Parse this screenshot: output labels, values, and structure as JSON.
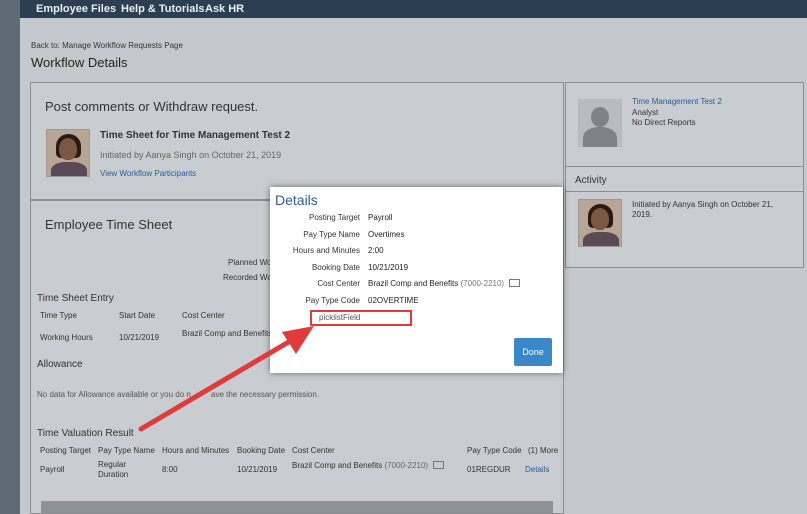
{
  "nav": {
    "items": [
      "Employee Files",
      "Help & Tutorials",
      "Ask HR"
    ]
  },
  "breadcrumb": "Back to: Manage Workflow Requests Page",
  "page_title": "Workflow Details",
  "comments_panel": {
    "title": "Post comments or Withdraw request.",
    "request_title": "Time Sheet for Time Management Test 2",
    "initiated": "Initiated by Aanya Singh on October 21, 2019",
    "participants_link": "View Workflow Participants"
  },
  "profile": {
    "name": "Time Management Test 2",
    "role": "Analyst",
    "reports": "No Direct Reports"
  },
  "activity": {
    "title": "Activity",
    "entry": [
      "Initiated by Aanya Singh on October 21,",
      "2019."
    ]
  },
  "timesheet": {
    "title": "Employee Time Sheet",
    "planned_label": "Planned Wo",
    "recorded_label": "Recorded Wo",
    "entry_title": "Time Sheet Entry",
    "entry_headers": [
      "Time Type",
      "Start Date",
      "Cost Center"
    ],
    "entry_row": [
      "Working Hours",
      "10/21/2019",
      "Brazil Comp and Benefits"
    ],
    "allowance_title": "Allowance",
    "allowance_text": "No data for Allowance available or you do n",
    "allowance_text_tail": "ave the necessary permission.",
    "valuation_title": "Time Valuation Result",
    "valuation_headers": [
      "Posting Target",
      "Pay Type Name",
      "Hours and Minutes",
      "Booking Date",
      "Cost Center",
      "Pay Type Code",
      "(1) More"
    ],
    "valuation_row": {
      "posting_target": "Payroll",
      "pay_type_name": [
        "Regular",
        "Duration"
      ],
      "hours": "8:00",
      "date": "10/21/2019",
      "cost_center": "Brazil Comp and Benefits",
      "cost_code": "(7000-2210)",
      "pay_type_code": "01REGDUR",
      "details_link": "Details"
    }
  },
  "modal": {
    "title": "Details",
    "fields": [
      {
        "label": "Posting Target",
        "value": "Payroll"
      },
      {
        "label": "Pay Type Name",
        "value": "Overtimes"
      },
      {
        "label": "Hours and Minutes",
        "value": "2:00"
      },
      {
        "label": "Booking Date",
        "value": "10/21/2019"
      },
      {
        "label": "Cost Center",
        "value": "Brazil Comp and Benefits",
        "code": "(7000-2210)"
      },
      {
        "label": "Pay Type Code",
        "value": "02OVERTIME"
      }
    ],
    "picklist_label": "picklistField",
    "done_label": "Done"
  },
  "colors": {
    "nav_bg": "#2c3f52",
    "link": "#2a5d96",
    "button": "#3a87c9",
    "annotation": "#e03a3a"
  }
}
